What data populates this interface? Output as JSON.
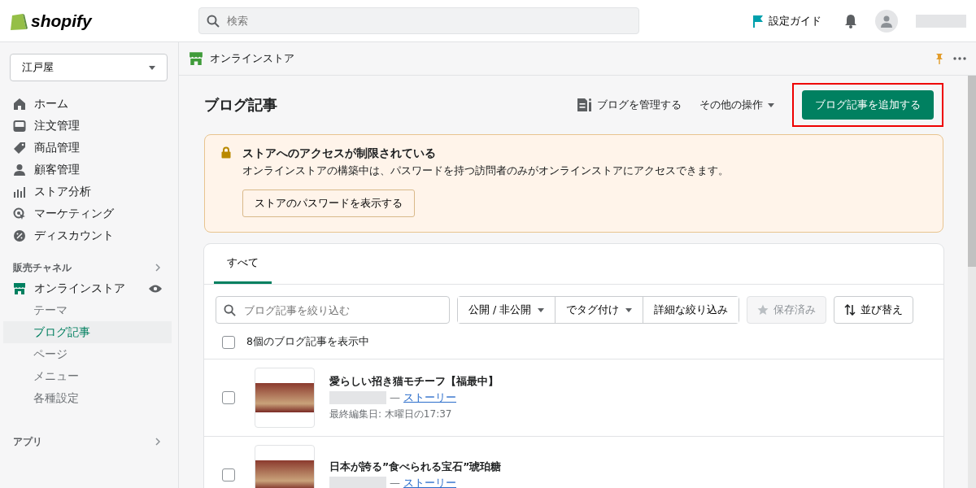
{
  "topbar": {
    "logo": "shopify",
    "search": {
      "placeholder": "検索"
    },
    "setup_guide": "設定ガイド"
  },
  "sidebar": {
    "store_selector": "江戸屋",
    "nav": [
      {
        "label": "ホーム",
        "kind": "home",
        "selected": false
      },
      {
        "label": "注文管理",
        "kind": "orders",
        "selected": false
      },
      {
        "label": "商品管理",
        "kind": "tag",
        "selected": false
      },
      {
        "label": "顧客管理",
        "kind": "person",
        "selected": false
      },
      {
        "label": "ストア分析",
        "kind": "bars",
        "selected": false
      },
      {
        "label": "マーケティング",
        "kind": "target",
        "selected": false
      },
      {
        "label": "ディスカウント",
        "kind": "discount",
        "selected": false
      }
    ],
    "sales_heading": "販売チャネル",
    "channel": {
      "label": "オンラインストア",
      "children": [
        {
          "label": "テーマ",
          "selected": false
        },
        {
          "label": "ブログ記事",
          "selected": true
        },
        {
          "label": "ページ",
          "selected": false
        },
        {
          "label": "メニュー",
          "selected": false
        },
        {
          "label": "各種設定",
          "selected": false
        }
      ]
    },
    "apps_heading": "アプリ"
  },
  "subheader": {
    "title": "オンラインストア"
  },
  "page": {
    "title": "ブログ記事",
    "manage": "ブログを管理する",
    "more": "その他の操作",
    "primary": "ブログ記事を追加する"
  },
  "banner": {
    "title": "ストアへのアクセスが制限されている",
    "text": "オンラインストアの構築中は、パスワードを持つ訪問者のみがオンラインストアにアクセスできます。",
    "button": "ストアのパスワードを表示する"
  },
  "list": {
    "tabs": [
      {
        "label": "すべて",
        "selected": true
      }
    ],
    "filter": {
      "placeholder": "ブログ記事を絞り込む"
    },
    "filters": [
      {
        "label": "公開 / 非公開",
        "dropdown": true
      },
      {
        "label": "でタグ付け",
        "dropdown": true
      },
      {
        "label": "詳細な絞り込み",
        "dropdown": false
      }
    ],
    "saved": {
      "label": "保存済み",
      "disabled": true
    },
    "sort": "並び替え",
    "select_all": {
      "label": "8個のブログ記事を表示中",
      "checked": false
    },
    "rows": [
      {
        "title": "愛らしい招き猫モチーフ【福最中】",
        "separator": "—",
        "blog": "ストーリー",
        "edited": "最終編集日: 木曜日の17:37",
        "checked": false
      },
      {
        "title": "日本が誇る”食べられる宝石”琥珀糖",
        "separator": "—",
        "blog": "ストーリー",
        "checked": false
      }
    ]
  }
}
